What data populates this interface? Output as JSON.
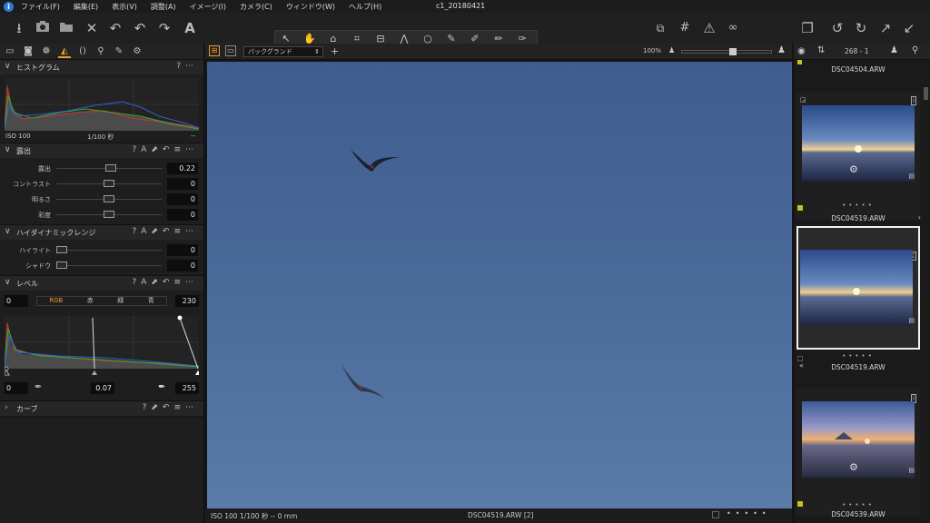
{
  "app": {
    "window_title": "c1_20180421",
    "menu": [
      "ファイル(F)",
      "編集(E)",
      "表示(V)",
      "調整(A)",
      "イメージ(I)",
      "カメラ(C)",
      "ウィンドウ(W)",
      "ヘルプ(H)"
    ]
  },
  "icons": {
    "import": "⭳",
    "camera": "📷",
    "export": "⮕",
    "delete": "✕",
    "undo_all": "↶",
    "undo": "↶",
    "redo": "↷",
    "text": "A",
    "compare": "⧉",
    "grid": "#",
    "warning": "⚠",
    "glasses": "∞",
    "windows": "❐",
    "rotate_left": "↺",
    "rotate_right": "↻",
    "expand": "↗",
    "collapse": "↙"
  },
  "left": {
    "histogram": {
      "title": "ヒストグラム",
      "iso": "ISO 100",
      "shutter": "1/100 秒",
      "extra": "--"
    },
    "exposure": {
      "title": "露出",
      "sliders": [
        {
          "label": "露出",
          "value": "0.22",
          "pos": 0.52
        },
        {
          "label": "コントラスト",
          "value": "0",
          "pos": 0.5
        },
        {
          "label": "明るさ",
          "value": "0",
          "pos": 0.5
        },
        {
          "label": "彩度",
          "value": "0",
          "pos": 0.5
        }
      ]
    },
    "hdr": {
      "title": "ハイダイナミックレンジ",
      "sliders": [
        {
          "label": "ハイライト",
          "value": "0",
          "pos": 0.0
        },
        {
          "label": "シャドウ",
          "value": "0",
          "pos": 0.0
        }
      ]
    },
    "levels": {
      "title": "レベル",
      "input_low": "0",
      "input_high": "230",
      "channels": [
        "RGB",
        "赤",
        "緑",
        "青"
      ],
      "output_low": "0",
      "midpoint": "0.07",
      "output_high": "255"
    },
    "curve": {
      "title": "カーブ"
    }
  },
  "viewer": {
    "background_label": "バックグランド",
    "zoom": "100%",
    "status_left": "ISO 100  1/100 秒 -- 0 mm",
    "status_center": "DSC04519.ARW [2]"
  },
  "browser": {
    "counter": "268 - 1",
    "top_name": "DSC04504.ARW",
    "items": [
      {
        "name": "DSC04519.ARW",
        "selected": false
      },
      {
        "name": "DSC04519.ARW",
        "selected": true
      },
      {
        "name": "DSC04539.ARW",
        "selected": false
      }
    ]
  }
}
